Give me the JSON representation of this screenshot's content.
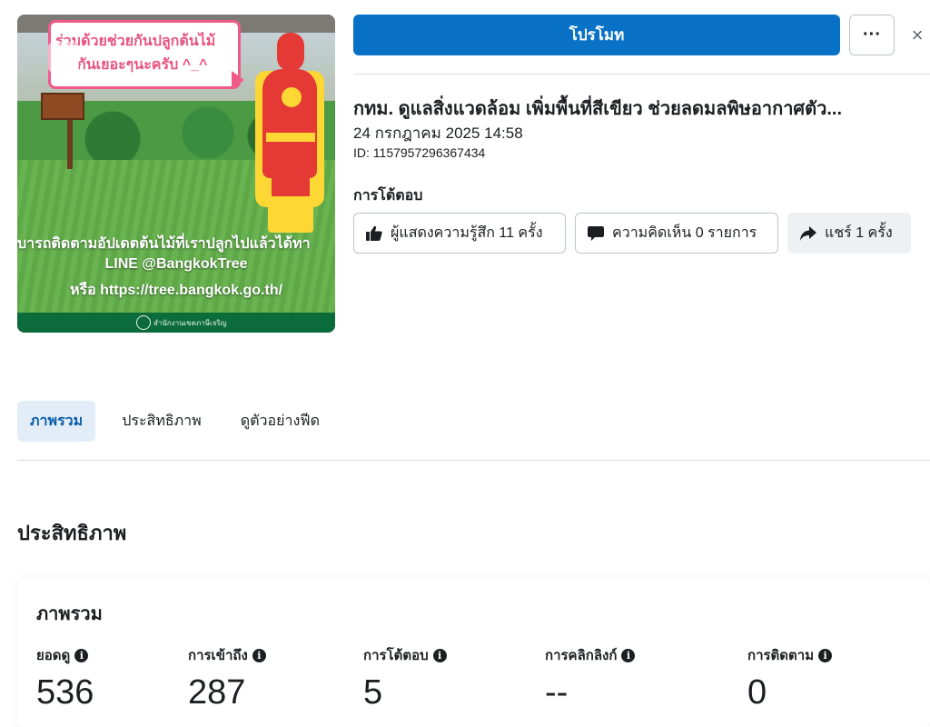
{
  "thumbnail": {
    "bubble_line1": "ร่วมด้วยช่วยกันปลูกต้นไม้",
    "bubble_line2": "กันเยอะๆนะครับ ^_^",
    "caption_line1": "บารถติดตามอัปเดตต้นไม้ที่เราปลูกไปแล้วได้ทา",
    "caption_line2": "LINE @BangkokTree",
    "caption_line3": "หรือ https://tree.bangkok.go.th/",
    "footer_text": "สำนักงานเขตภาษีเจริญ"
  },
  "header": {
    "promote_label": "โปรโมท",
    "more_label": "···",
    "close_label": "×"
  },
  "post": {
    "title": "กทม. ดูแลสิ่งแวดล้อม เพิ่มพื้นที่สีเขียว ช่วยลดมลพิษอากาศตัว...",
    "date": "24 กรกฎาคม 2025 14:58",
    "id": "ID: 1157957296367434"
  },
  "engagement": {
    "heading": "การโต้ตอบ",
    "reactions": "ผู้แสดงความรู้สึก 11 ครั้ง",
    "comments": "ความคิดเห็น 0 รายการ",
    "shares": "แชร์ 1 ครั้ง"
  },
  "tabs": [
    {
      "label": "ภาพรวม",
      "active": true
    },
    {
      "label": "ประสิทธิภาพ",
      "active": false
    },
    {
      "label": "ดูตัวอย่างฟีด",
      "active": false
    }
  ],
  "performance": {
    "heading": "ประสิทธิภาพ",
    "card_title": "ภาพรวม",
    "metrics": [
      {
        "label": "ยอดดู",
        "value": "536"
      },
      {
        "label": "การเข้าถึง",
        "value": "287"
      },
      {
        "label": "การโต้ตอบ",
        "value": "5"
      },
      {
        "label": "การคลิกลิงก์",
        "value": "--"
      },
      {
        "label": "การติดตาม",
        "value": "0"
      }
    ]
  },
  "colors": {
    "accent": "#0a72c6",
    "active_tab_bg": "#e3edf8"
  }
}
